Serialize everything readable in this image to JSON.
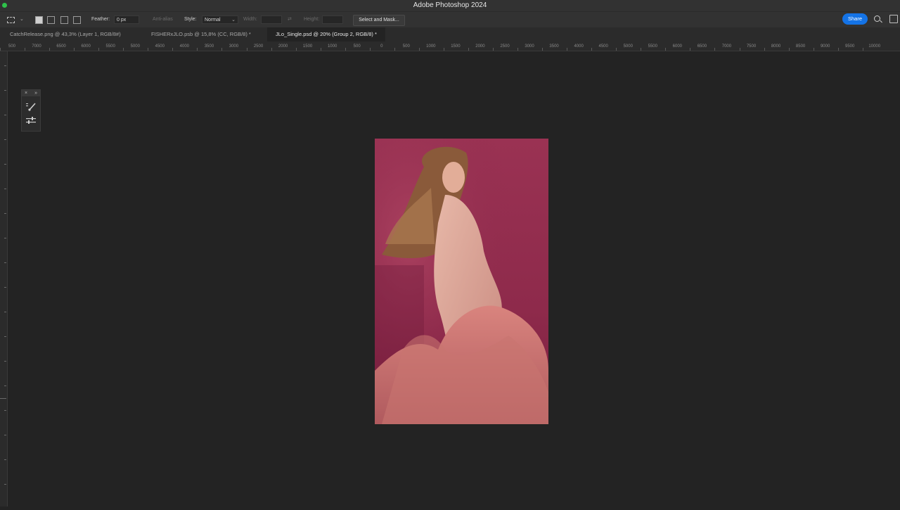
{
  "app": {
    "title": "Adobe Photoshop 2024"
  },
  "options": {
    "feather_label": "Feather:",
    "feather_value": "0 px",
    "antialias_label": "Anti-alias",
    "style_label": "Style:",
    "style_value": "Normal",
    "width_label": "Width:",
    "height_label": "Height:",
    "select_mask_label": "Select and Mask...",
    "share_label": "Share"
  },
  "tabs": [
    {
      "label": "CatchRelease.png @ 43,3% (Layer 1, RGB/8#)"
    },
    {
      "label": "FISHERxJLO.psb @ 15,8% (CC, RGB/8) *"
    },
    {
      "label": "JLo_Single.psd @ 20% (Group 2, RGB/8) *"
    }
  ],
  "ruler": {
    "h_ticks": [
      "500",
      "7000",
      "6500",
      "6000",
      "5500",
      "5000",
      "4500",
      "4000",
      "3500",
      "3000",
      "2500",
      "2000",
      "1500",
      "1000",
      "500",
      "0",
      "500",
      "1000",
      "1500",
      "2000",
      "2500",
      "3000",
      "3500",
      "4000",
      "4500",
      "5000",
      "5500",
      "6000",
      "6500",
      "7000",
      "7500",
      "8000",
      "8500",
      "9000",
      "9500",
      "10000",
      "1"
    ]
  },
  "colors": {
    "accent": "#1473e6",
    "background": "#232323",
    "canvas_bg": "#8e2a4b"
  }
}
